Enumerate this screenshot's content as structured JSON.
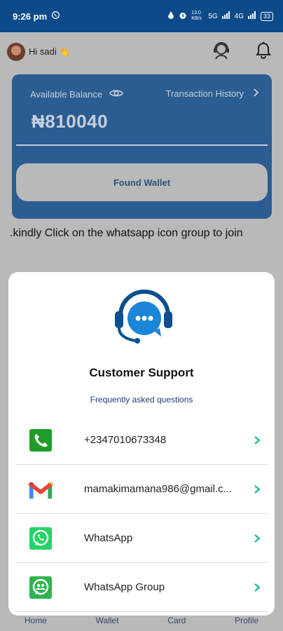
{
  "status_bar": {
    "time": "9:26 pm",
    "net_speed": "13.0 KB/s",
    "signal_1": "5G",
    "signal_2": "4G",
    "battery": "33"
  },
  "header": {
    "greeting": "Hi sadi 👋"
  },
  "balance_card": {
    "balance_label": "Available Balance",
    "history_label": "Transaction History",
    "amount": "₦810040",
    "fund_button": "Found Wallet"
  },
  "notice": ".kindly Click on the whatsapp icon group to join",
  "support": {
    "title": "Customer Support",
    "subtitle": "Frequently asked questions",
    "contacts": [
      {
        "label": "+2347010673348",
        "icon": "phone-icon"
      },
      {
        "label": "mamakimamana986@gmail.c...",
        "icon": "gmail-icon"
      },
      {
        "label": "WhatsApp",
        "icon": "whatsapp-icon"
      },
      {
        "label": "WhatsApp Group",
        "icon": "whatsapp-group-icon"
      }
    ]
  },
  "bottom_nav": [
    "Home",
    "Wallet",
    "Card",
    "Profile"
  ],
  "colors": {
    "primary": "#0d4a8a",
    "whatsapp_green": "#25d366",
    "phone_green": "#1f9c2a",
    "chevron": "#15b8a0"
  }
}
